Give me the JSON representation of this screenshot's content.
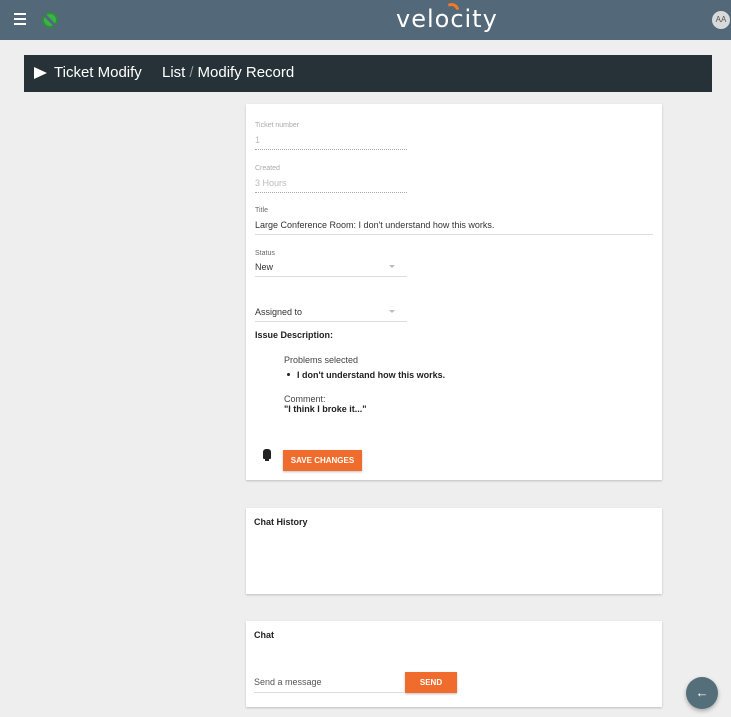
{
  "topbar": {
    "logo": "velocity",
    "avatar_initials": "AA"
  },
  "pagebar": {
    "title": "Ticket Modify",
    "crumb_list": "List",
    "crumb_sep": "/",
    "crumb_current": "Modify Record"
  },
  "ticket": {
    "ticket_number_label": "Ticket number",
    "ticket_number": "1",
    "created_label": "Created",
    "created": "3 Hours",
    "title_label": "Title",
    "title": "Large Conference Room: I don't understand how this works.",
    "status_label": "Status",
    "status": "New",
    "assigned_to": "Assigned to",
    "issue_description_label": "Issue Description:",
    "problems_selected_label": "Problems selected",
    "problems": [
      "I don't understand how this works."
    ],
    "comment_label": "Comment:",
    "comment": "\"I think I broke it...\"",
    "save_label": "SAVE CHANGES"
  },
  "chat_history": {
    "title": "Chat History"
  },
  "chat": {
    "title": "Chat",
    "placeholder": "Send a message",
    "send_label": "SEND"
  },
  "icons": {
    "menu": "menu-icon",
    "status": "status-disconnected-icon",
    "headset": "headset-icon",
    "back": "arrow-left-icon"
  },
  "colors": {
    "topbar": "#536878",
    "pagebar": "#263238",
    "accent": "#ef6c2c"
  }
}
